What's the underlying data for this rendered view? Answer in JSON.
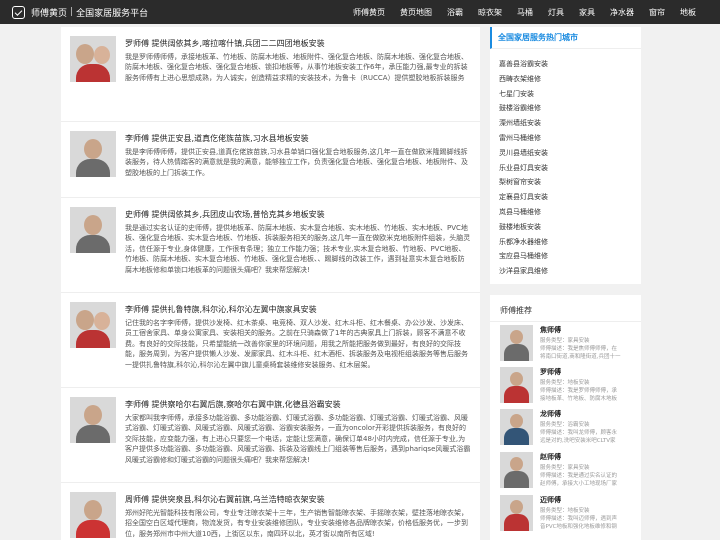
{
  "header": {
    "brand": "师傅黄页",
    "subtitle": "全国家居服务平台",
    "nav": [
      "师傅黄页",
      "黄页地图",
      "浴霸",
      "晾衣架",
      "马桶",
      "灯具",
      "家具",
      "净水器",
      "窗帘",
      "地板"
    ]
  },
  "listings": [
    {
      "title": "罗师傅 提供阔依其乡,喀拉喀什镇,兵团二二四团地板安装",
      "desc": "我是罗师傅师傅，承接地板革、竹地板、防腐木地板、地板附件、强化复合地板、防腐木地板、强化复合地板、防腐木地板、强化复合地板、强化复合地板、锁扣地板等，从事竹地板安装工作6年，承压能力强,最专业的拆装服务师傅有上进心思想成熟，为人诚实，创造精益求精的安装技术，为鲁卡（RUCCA）提供塑胶地板拆装服务相关的工作有地板附件组装等家具问题、尽快开口。"
    },
    {
      "title": "李师傅 提供正安县,道真仡佬族苗族,习水县地板安装",
      "desc": "我是李师傅师傅，提供正安县,道真仡佬族苗族,习水县单销口强化复合地板服务,这几年一直在做欧米隆踢脚线拆装服务，待人热情踏客的满意就是我的满意，能够独立工作，负责强化复合地板、强化复合地板、地板附件、及塑胶地板的上门拆装工作。"
    },
    {
      "title": "史师傅 提供阔依其乡,兵团皮山农场,普恰克其乡地板安装",
      "desc": "我是通过实名认证的史师傅，提供地板革、防腐木地板、实木复合地板、实木地板、竹地板、实木地板、PVC地板、强化复合地板、实木复合地板、竹地板、拆装服务相关的服务,这几年一直在做欧米克地板附件组装，头脑灵活，信任源于专业,身体健康，工作很有条理；独立工作能力强；技术专业,实木复合地板、竹地板、PVC地板、竹地板、防腐木地板、实木复合地板、竹地板、强化复合地板、、踢脚线的改装工作，遇到祉意实木复合地板防腐木地板修和单锁口地板革的问题很头痛吧？我来帮您解决!"
    },
    {
      "title": "李师傅 提供扎鲁特旗,科尔沁,科尔沁左翼中旗家具安装",
      "desc": "记住我的名字李师傅，提供沙发椅、红木茶桌、电竞椅、双人沙发、红木斗柜、红木餐桌、办公沙发、沙发床、员工宿舍家具、单身公寓家具、安装相关的服务。之前在只骑森做了1年的古典家具上门拆装，顾客不满意不收费。有良好的交际技能，只希望能统一改善你家里的环境问题，用我之所能把服务做到最好，有良好的交际技能，服务周到，为客户提供懒人沙发、发廊家具、红木斗柜、红木酒柜、拆装服务及电视柜组装服务等售后服务一提供扎鲁特旗,科尔沁,科尔沁左翼中旗儿童桌椅套装维修安装服务、红木层架。"
    },
    {
      "title": "李师傅 提供察哈尔右翼后旗,察哈尔右翼中旗,化德县浴霸安装",
      "desc": "大家都叫我李师傅，承接多功能浴霸、多功能浴霸、灯暖式浴霸、多功能浴霸、灯暖式浴霸、灯暖式浴霸、风暖式浴霸、灯暖式浴霸、风暖式浴霸、风暖式浴霸、浴霸安装服务，一直为oncolor开彩提供拆装服务，有良好的交际技能，应变能力强，有上进心只要您一个电话，定能让您满意，确保订单48小时内完成，信任源于专业,为客户提供多功能浴霸、多功能浴霸、风暖式浴霸、拆装及浴霸线上门组装等售后服务，遇到phariqse风暖式浴霸风暖式浴霸修和灯暖式浴霸的问题很头痛吧？我来帮您解决!"
    },
    {
      "title": "周师傅 提供突泉县,科尔沁右翼前旗,乌兰浩特晾衣架安装",
      "desc": "郑州好陀光智能科技有限公司，专业专注晾衣架十三年，生产销售智能晾衣架、手摇晾衣架，壁挂落地晾衣架，招全国空白区域代理商，物流发货，有专业安装维修团队，专业安装维修各品牌晾衣架，价格低服务优，一步到位，服务郑州市中州大道10西，上街区以东，南四环以北，英才街以南所有区域!"
    }
  ],
  "sidebar": {
    "cities_title": "全国家居服务热门城市",
    "cities": [
      "嘉善县浴霸安装",
      "西畴衣架维修",
      "七星门安装",
      "鼓楼浴霸维修",
      "溧州墙纸安装",
      "雷州马桶维修",
      "灵川县墙纸安装",
      "乐业县灯具安装",
      "梨树窗帘安装",
      "定襄县灯具安装",
      "岚县马桶维修",
      "鼓楼地板安装",
      "乐都净水器维修",
      "宝应县马桶维修",
      "沙洋县家具维修"
    ],
    "recommend_title": "师傅推荐",
    "masters": [
      {
        "name": "焦师傅",
        "lines": [
          "服务类型：家具安装",
          "师傅描述：我是焦师傅师傅，在",
          "将南口街道,商和隆街道,兵团十一"
        ]
      },
      {
        "name": "罗师傅",
        "lines": [
          "服务类型：地板安装",
          "师傅描述：我是罗师傅师傅，承",
          "接地板革、竹地板、防腐木地板"
        ]
      },
      {
        "name": "龙师傅",
        "lines": [
          "服务类型：浴霸安装",
          "师傅描述：我叫龙师傅，顾客永",
          "远是对的,洗吧安装米吧CLTV家"
        ]
      },
      {
        "name": "赵师傅",
        "lines": [
          "服务类型：家具安装",
          "师傅描述：我是通过实名认证的",
          "赵师傅，承接大小工地现场厂家"
        ]
      },
      {
        "name": "迈师傅",
        "lines": [
          "服务类型：地板安装",
          "师傅描述：我叫迈师傅，遇到声",
          "音PVC地板和强化地板维修和钢"
        ]
      }
    ]
  }
}
